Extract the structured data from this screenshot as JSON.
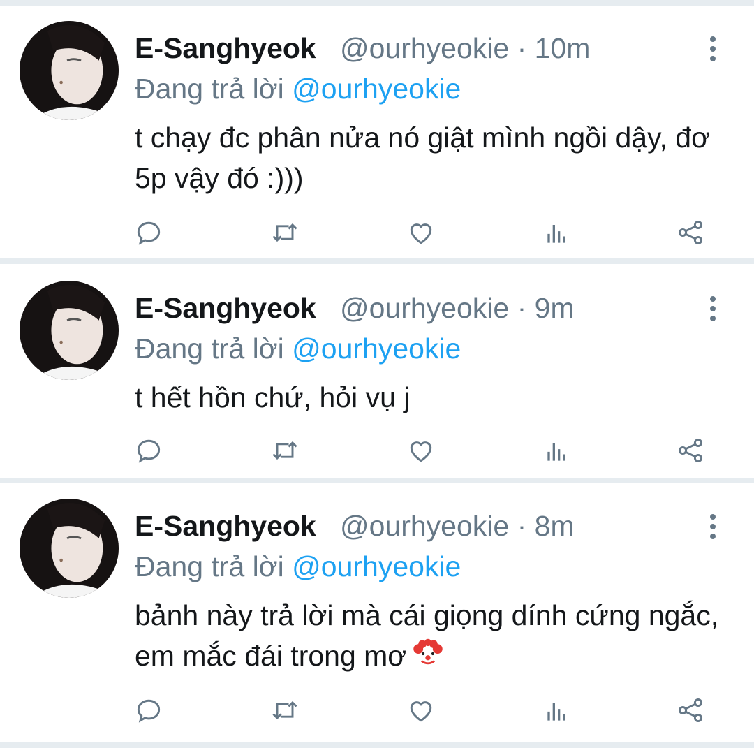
{
  "tweets": [
    {
      "name": "E-Sanghyeok",
      "handle": "@ourhyeokie",
      "separator": "·",
      "time": "10m",
      "reply_prefix": "Đang trả lời",
      "reply_mention": "@ourhyeokie",
      "text": "t chạy đc phân nửa nó giật mình ngồi dậy, đơ 5p vậy đó :)))",
      "emoji": ""
    },
    {
      "name": "E-Sanghyeok",
      "handle": "@ourhyeokie",
      "separator": "·",
      "time": "9m",
      "reply_prefix": "Đang trả lời",
      "reply_mention": "@ourhyeokie",
      "text": "t hết hồn chứ, hỏi vụ j",
      "emoji": ""
    },
    {
      "name": "E-Sanghyeok",
      "handle": "@ourhyeokie",
      "separator": "·",
      "time": "8m",
      "reply_prefix": "Đang trả lời",
      "reply_mention": "@ourhyeokie",
      "text": "bảnh này trả lời mà cái giọng dính cứng ngắc, em mắc đái trong mơ",
      "emoji": "clown-face-emoji"
    }
  ],
  "actions": [
    "reply-icon",
    "retweet-icon",
    "like-icon",
    "analytics-icon",
    "share-icon"
  ],
  "colors": {
    "text": "#14171a",
    "secondary": "#657786",
    "mention": "#1da1f2",
    "divider": "#e6ecf0"
  }
}
